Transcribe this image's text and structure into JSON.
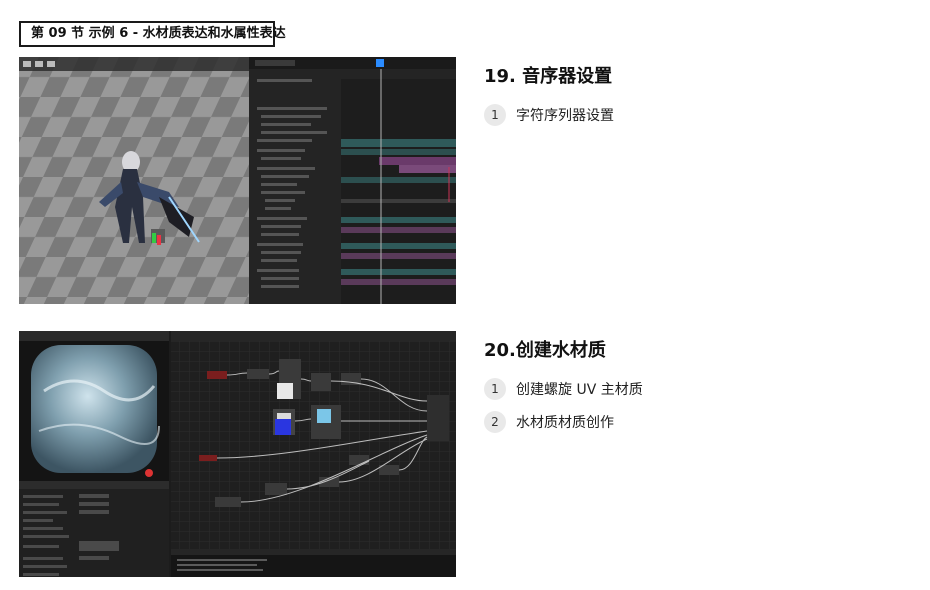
{
  "section": {
    "title": "第 09 节 示例 6 - 水材质表达和水属性表达"
  },
  "blocks": [
    {
      "heading": "19. 音序器设置",
      "steps": [
        {
          "number": "1",
          "label": "字符序列器设置"
        }
      ]
    },
    {
      "heading": "20.创建水材质",
      "steps": [
        {
          "number": "1",
          "label": "创建螺旋 UV 主材质"
        },
        {
          "number": "2",
          "label": "水材质材质创作"
        }
      ]
    }
  ]
}
